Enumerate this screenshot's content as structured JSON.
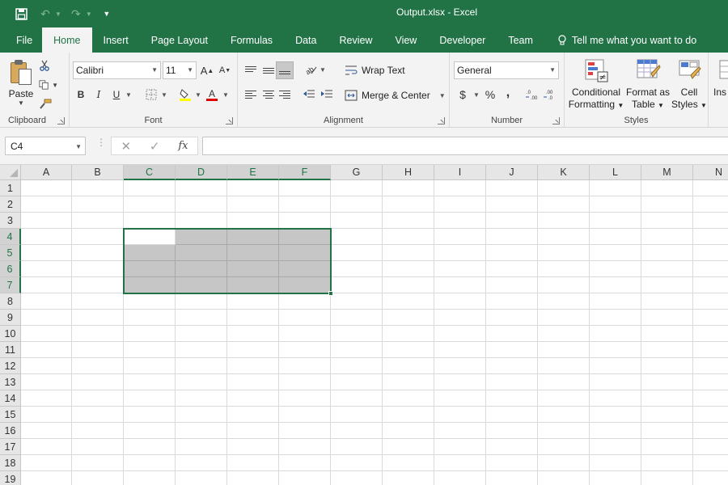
{
  "title": "Output.xlsx - Excel",
  "tabs": [
    "File",
    "Home",
    "Insert",
    "Page Layout",
    "Formulas",
    "Data",
    "Review",
    "View",
    "Developer",
    "Team"
  ],
  "active_tab": "Home",
  "tell_me": "Tell me what you want to do",
  "clipboard": {
    "paste": "Paste",
    "label": "Clipboard"
  },
  "font": {
    "name": "Calibri",
    "size": "11",
    "label": "Font",
    "bold": "B",
    "italic": "I",
    "underline": "U"
  },
  "alignment": {
    "wrap_text": "Wrap Text",
    "merge_center": "Merge & Center",
    "label": "Alignment"
  },
  "number": {
    "format": "General",
    "label": "Number",
    "currency": "$",
    "percent": "%",
    "comma": ","
  },
  "styles": {
    "conditional": [
      "Conditional",
      "Formatting"
    ],
    "format_table": [
      "Format as",
      "Table"
    ],
    "cell_styles": [
      "Cell",
      "Styles"
    ],
    "label": "Styles",
    "insert_partial": "Ins"
  },
  "formula_bar": {
    "name_box": "C4",
    "fx": "fx",
    "value": ""
  },
  "columns": [
    "A",
    "B",
    "C",
    "D",
    "E",
    "F",
    "G",
    "H",
    "I",
    "J",
    "K",
    "L",
    "M",
    "N"
  ],
  "rows": [
    "1",
    "2",
    "3",
    "4",
    "5",
    "6",
    "7",
    "8",
    "9",
    "10",
    "11",
    "12",
    "13",
    "14",
    "15",
    "16",
    "17",
    "18",
    "19"
  ],
  "selection": {
    "active_cell": "C4",
    "range": "C4:F7"
  },
  "colors": {
    "brand": "#217346",
    "selection_fill": "#c6c6c6"
  }
}
